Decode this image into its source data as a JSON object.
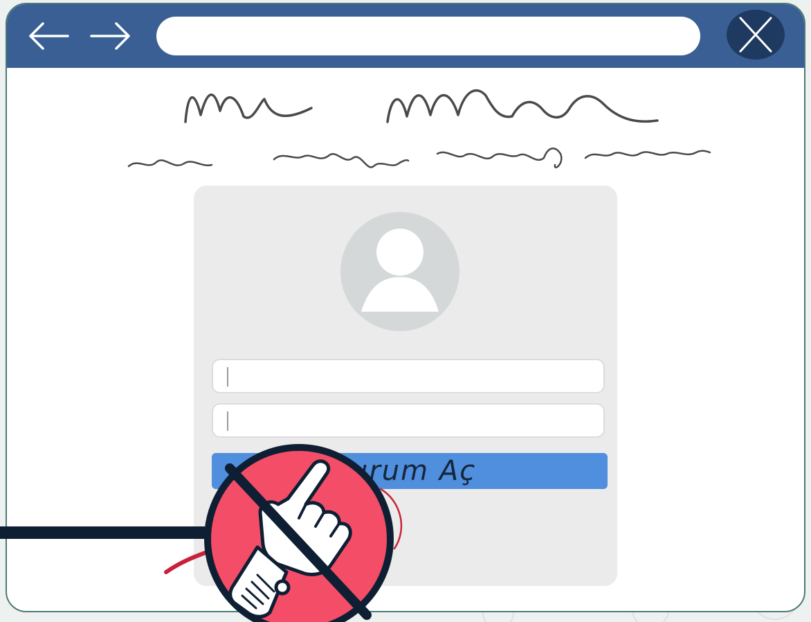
{
  "browser": {
    "url_value": "",
    "back_icon": "arrow-left-icon",
    "forward_icon": "arrow-right-icon",
    "close_icon": "close-icon"
  },
  "login_form": {
    "avatar_icon": "user-avatar-icon",
    "username_value": "",
    "password_value": "",
    "submit_label": "urum Aç"
  },
  "overlay": {
    "badge_icon": "no-click-hand-icon"
  },
  "colors": {
    "topbar": "#3a5f94",
    "button": "#4f8fdd",
    "badge": "#f34d67",
    "dark": "#0e1f33"
  }
}
